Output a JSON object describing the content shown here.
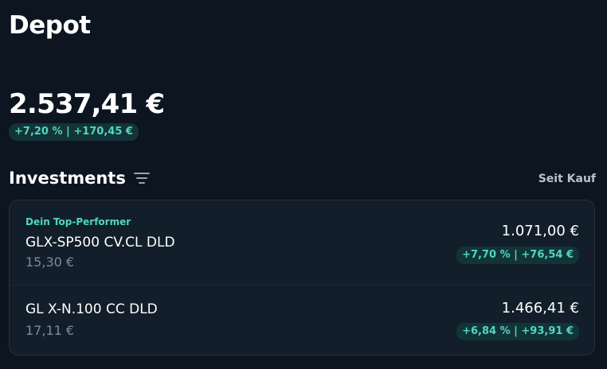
{
  "page": {
    "title": "Depot"
  },
  "portfolio": {
    "total_value": "2.537,41 €",
    "performance": "+7,20 % | +170,45 €"
  },
  "investments": {
    "title": "Investments",
    "filter_icon": "filter-icon",
    "period_label": "Seit Kauf",
    "holdings": [
      {
        "tag": "Dein Top-Performer",
        "name": "GLX-SP500 CV.CL DLD",
        "price": "15,30 €",
        "value": "1.071,00 €",
        "performance": "+7,70 % | +76,54 €"
      },
      {
        "name": "GL X-N.100 CC DLD",
        "price": "17,11 €",
        "value": "1.466,41 €",
        "performance": "+6,84 % | +93,91 €"
      }
    ]
  },
  "colors": {
    "background": "#0c1520",
    "card": "#121e29",
    "accent": "#4fd6c1",
    "badge_bg": "#133437",
    "muted_text": "#7e8b97"
  }
}
